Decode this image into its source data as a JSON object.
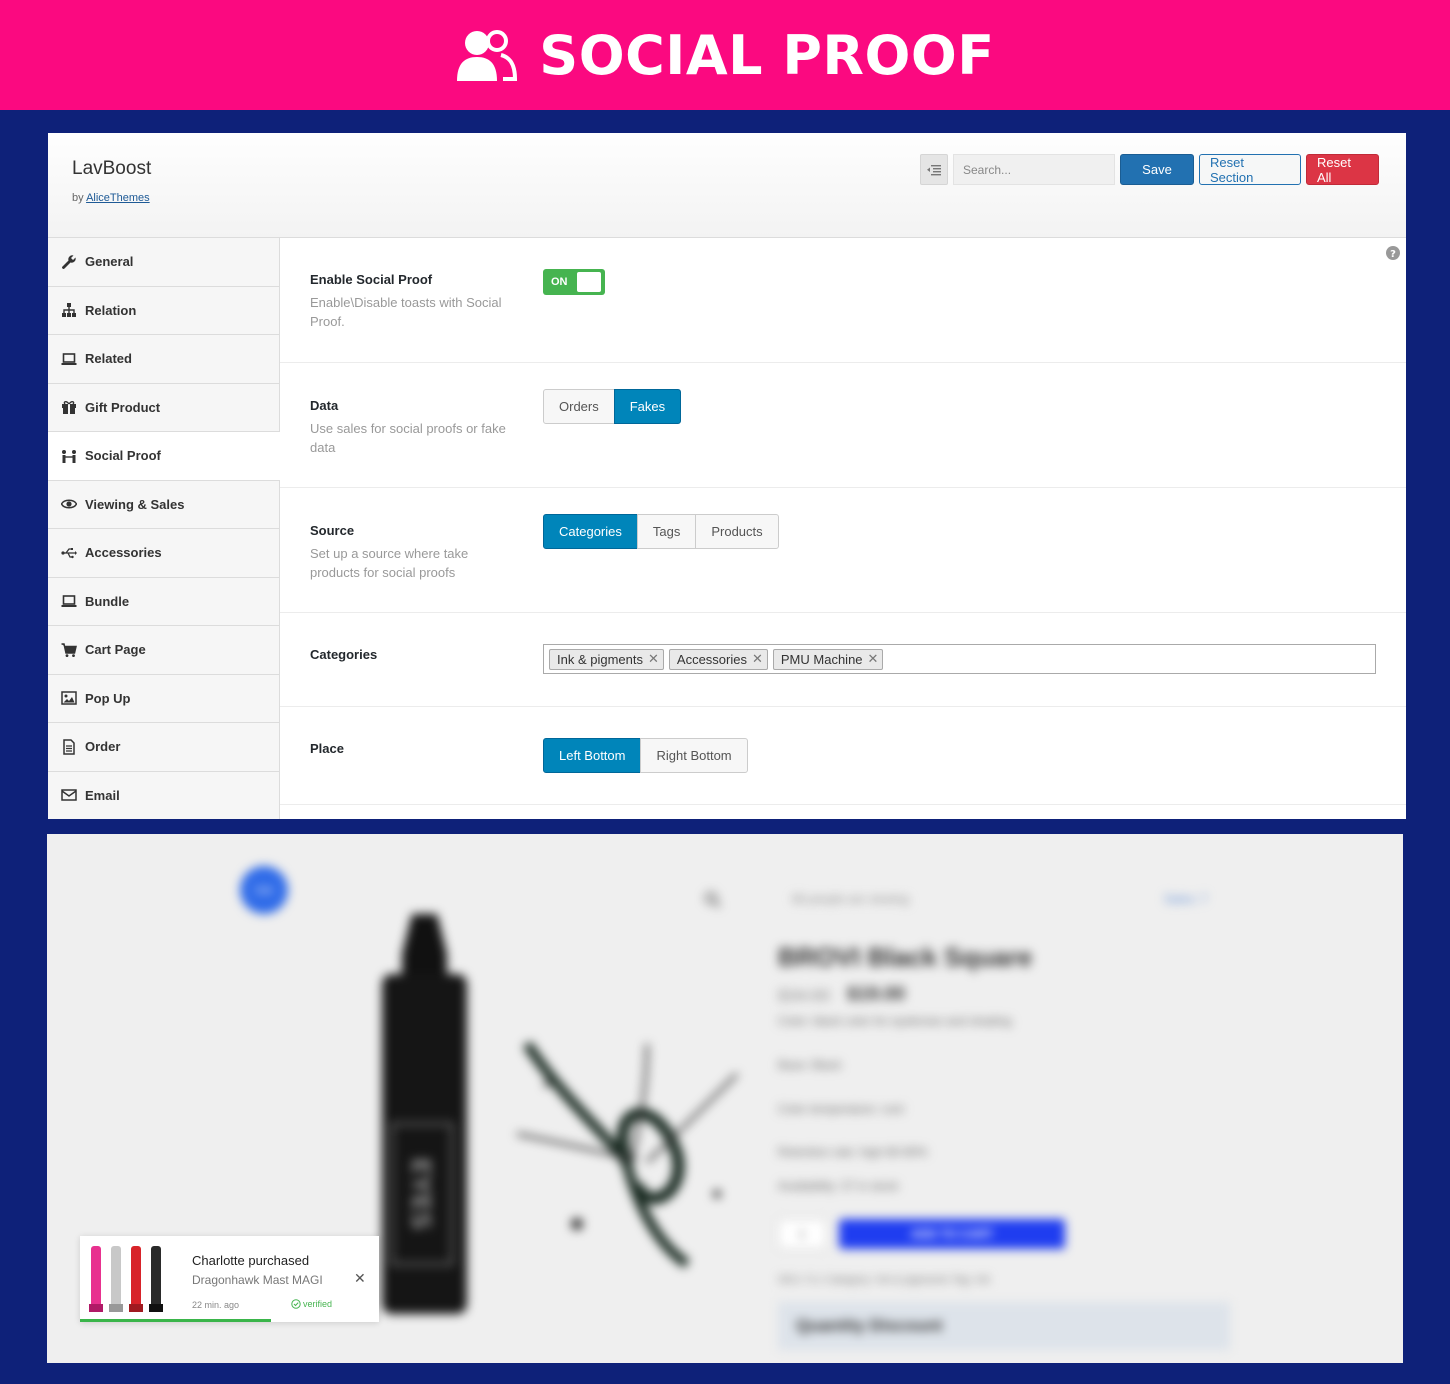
{
  "banner": {
    "title": "SOCIAL PROOF",
    "icon": "users-icon",
    "background": "#fb0980"
  },
  "app": {
    "name": "LavBoost",
    "by_prefix": "by",
    "author": "AliceThemes"
  },
  "header": {
    "search_placeholder": "Search...",
    "save_label": "Save",
    "reset_section_label": "Reset Section",
    "reset_all_label": "Reset All"
  },
  "sidebar": {
    "items": [
      {
        "label": "General",
        "icon": "wrench-icon"
      },
      {
        "label": "Relation",
        "icon": "sitemap-icon"
      },
      {
        "label": "Related",
        "icon": "laptop-icon"
      },
      {
        "label": "Gift Product",
        "icon": "gift-icon"
      },
      {
        "label": "Social Proof",
        "icon": "social-icon",
        "active": true
      },
      {
        "label": "Viewing & Sales",
        "icon": "eye-icon"
      },
      {
        "label": "Accessories",
        "icon": "usb-icon"
      },
      {
        "label": "Bundle",
        "icon": "laptop-icon"
      },
      {
        "label": "Cart Page",
        "icon": "cart-icon"
      },
      {
        "label": "Pop Up",
        "icon": "image-icon"
      },
      {
        "label": "Order",
        "icon": "file-icon"
      },
      {
        "label": "Email",
        "icon": "envelope-icon"
      }
    ]
  },
  "fields": {
    "enable": {
      "title": "Enable Social Proof",
      "desc": "Enable\\Disable toasts with Social Proof.",
      "toggle_label": "ON"
    },
    "data": {
      "title": "Data",
      "desc": "Use sales for social proofs or fake data",
      "options": [
        "Orders",
        "Fakes"
      ],
      "selected": "Fakes"
    },
    "source": {
      "title": "Source",
      "desc": "Set up a source where take products for social proofs",
      "options": [
        "Categories",
        "Tags",
        "Products"
      ],
      "selected": "Categories"
    },
    "categories": {
      "title": "Categories",
      "tags": [
        "Ink & pigments",
        "Accessories",
        "PMU Machine"
      ],
      "remove_glyph": "✕"
    },
    "place": {
      "title": "Place",
      "options": [
        "Left Bottom",
        "Right Bottom"
      ],
      "selected": "Left Bottom"
    }
  },
  "preview": {
    "badge": "Sale",
    "viewing": "66 people are viewing",
    "sales_link": "Sales: 7",
    "product_title": "BROVI Black Square",
    "old_price": "$34.00",
    "new_price": "$19.00",
    "specs": [
      "Color: black color for eyebrows and shading",
      "Base: Black",
      "Color temperature: cool",
      "Retention rate: high 80-90%",
      "Availability: 37 in stock"
    ],
    "quantity": "1",
    "cart_label": "ADD TO CART",
    "meta": "SKU: 5.1   Category: Ink & pigments   Tag: Ink",
    "discount_title": "Quantity Discount",
    "bottle_label": "EYES"
  },
  "toast": {
    "name": "Charlotte purchased",
    "product": "Dragonhawk Mast MAGI",
    "time": "22 min. ago",
    "verified": "verified",
    "close_glyph": "✕",
    "progress": 0.64
  }
}
